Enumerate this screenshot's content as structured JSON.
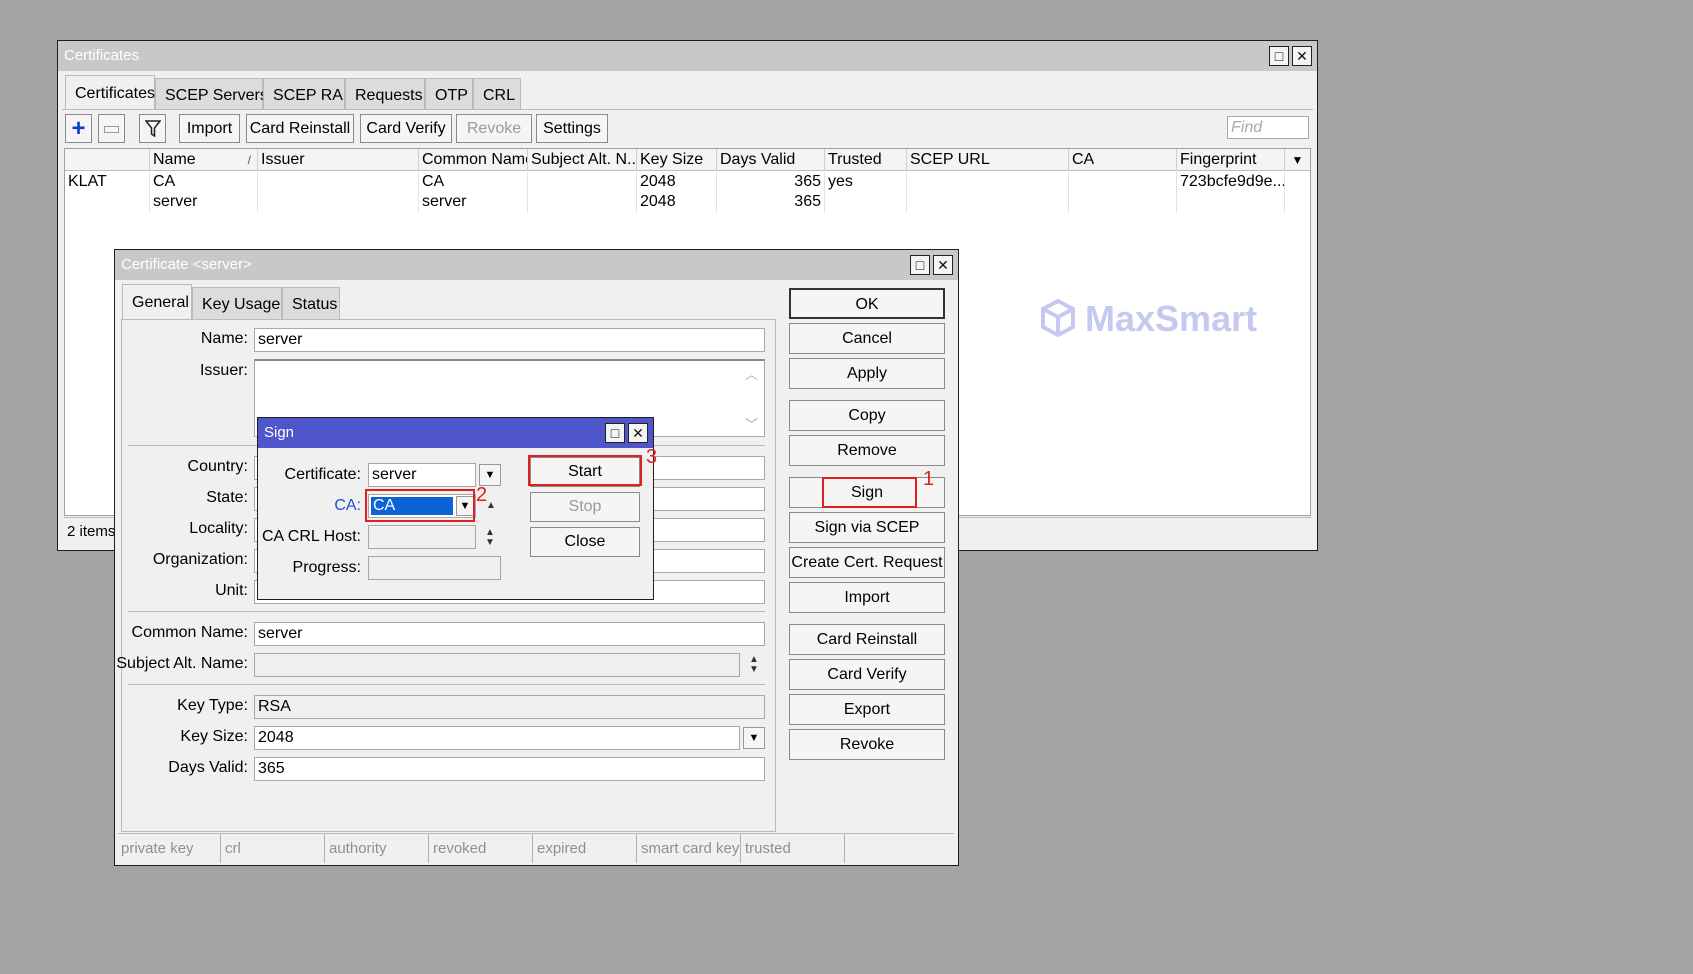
{
  "certificates_window": {
    "title": "Certificates",
    "tabs": [
      "Certificates",
      "SCEP Servers",
      "SCEP RA",
      "Requests",
      "OTP",
      "CRL"
    ],
    "toolbar": {
      "import": "Import",
      "card_reinstall": "Card Reinstall",
      "card_verify": "Card Verify",
      "revoke": "Revoke",
      "settings": "Settings",
      "find_placeholder": "Find"
    },
    "columns": [
      "",
      "Name",
      "Issuer",
      "Common Name",
      "Subject Alt. N...",
      "Key Size",
      "Days Valid",
      "Trusted",
      "SCEP URL",
      "CA",
      "Fingerprint"
    ],
    "rows": [
      [
        "KLAT",
        "CA",
        "",
        "CA",
        "",
        "2048",
        "365",
        "yes",
        "",
        "",
        "723bcfe9d9e..."
      ],
      [
        "",
        "server",
        "",
        "server",
        "",
        "2048",
        "365",
        "",
        "",
        "",
        ""
      ]
    ],
    "status": "2 items",
    "sort_indicator": "/"
  },
  "watermark": "MaxSmart",
  "cert_dialog": {
    "title": "Certificate <server>",
    "tabs": [
      "General",
      "Key Usage",
      "Status"
    ],
    "labels": {
      "name": "Name:",
      "issuer": "Issuer:",
      "country": "Country:",
      "state": "State:",
      "locality": "Locality:",
      "organization": "Organization:",
      "unit": "Unit:",
      "common_name": "Common Name:",
      "subject_alt_name": "Subject Alt. Name:",
      "key_type": "Key Type:",
      "key_size": "Key Size:",
      "days_valid": "Days Valid:"
    },
    "values": {
      "name": "server",
      "common_name": "server",
      "key_type": "RSA",
      "key_size": "2048",
      "days_valid": "365"
    },
    "buttons": [
      "OK",
      "Cancel",
      "Apply",
      "Copy",
      "Remove",
      "Sign",
      "Sign via SCEP",
      "Create Cert. Request",
      "Import",
      "Card Reinstall",
      "Card Verify",
      "Export",
      "Revoke"
    ],
    "flags": [
      "private key",
      "crl",
      "authority",
      "revoked",
      "expired",
      "smart card key",
      "trusted",
      ""
    ]
  },
  "sign_dialog": {
    "title": "Sign",
    "labels": {
      "certificate": "Certificate:",
      "ca": "CA:",
      "ca_crl_host": "CA CRL Host:",
      "progress": "Progress:"
    },
    "values": {
      "certificate": "server",
      "ca": "CA"
    },
    "buttons": {
      "start": "Start",
      "stop": "Stop",
      "close": "Close"
    }
  },
  "annotations": {
    "step1": "1",
    "step2": "2",
    "step3": "3"
  },
  "colors": {
    "highlight": "#e02020",
    "selection": "#0a64d6",
    "ca_label": "#1f4fd8",
    "sign_title": "#4f56c9",
    "plus": "#0a3fc4"
  }
}
